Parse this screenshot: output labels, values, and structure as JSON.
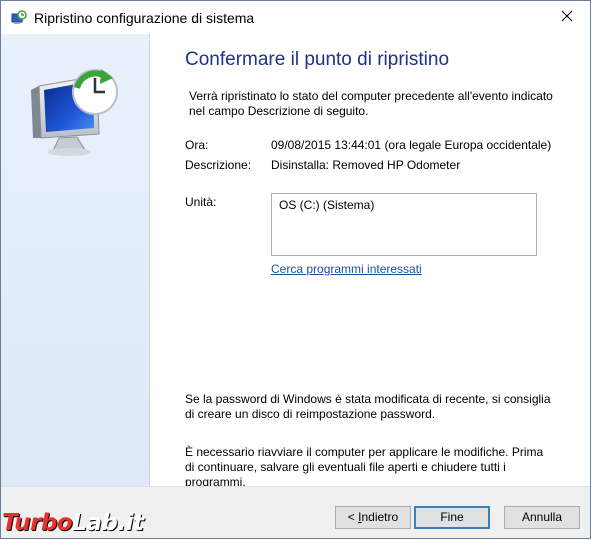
{
  "window": {
    "title": "Ripristino configurazione di sistema",
    "close_icon": "close-icon"
  },
  "main": {
    "heading": "Confermare il punto di ripristino",
    "description": "Verrà ripristinato lo stato del computer precedente all'evento indicato nel campo Descrizione di seguito.",
    "time_label": "Ora:",
    "time_value": "09/08/2015 13:44:01 (ora legale Europa occidentale)",
    "description_label": "Descrizione:",
    "description_value": "Disinstalla: Removed HP Odometer",
    "drives_label": "Unità:",
    "drives_value": "OS (C:) (Sistema)",
    "scan_link": "Cerca programmi interessati",
    "password_note": "Se la password di Windows è stata modificata di recente, si consiglia di creare un disco di reimpostazione password.",
    "restart_note": "È necessario riavviare il computer per applicare le modifiche. Prima di continuare, salvare gli eventuali file aperti e chiudere tutti i programmi."
  },
  "footer": {
    "back_prefix": "< ",
    "back_accel": "I",
    "back_rest": "ndietro",
    "finish_label": "Fine",
    "cancel_label": "Annulla"
  },
  "watermark": {
    "part1": "Turbo",
    "part2": "Lab.it"
  },
  "colors": {
    "heading": "#1e3287",
    "link": "#1a4e9c",
    "sidebar": "#e3edf9",
    "default_button_border": "#3c7fb1",
    "watermark_red": "#e8302a",
    "watermark_white": "#ffffff"
  }
}
